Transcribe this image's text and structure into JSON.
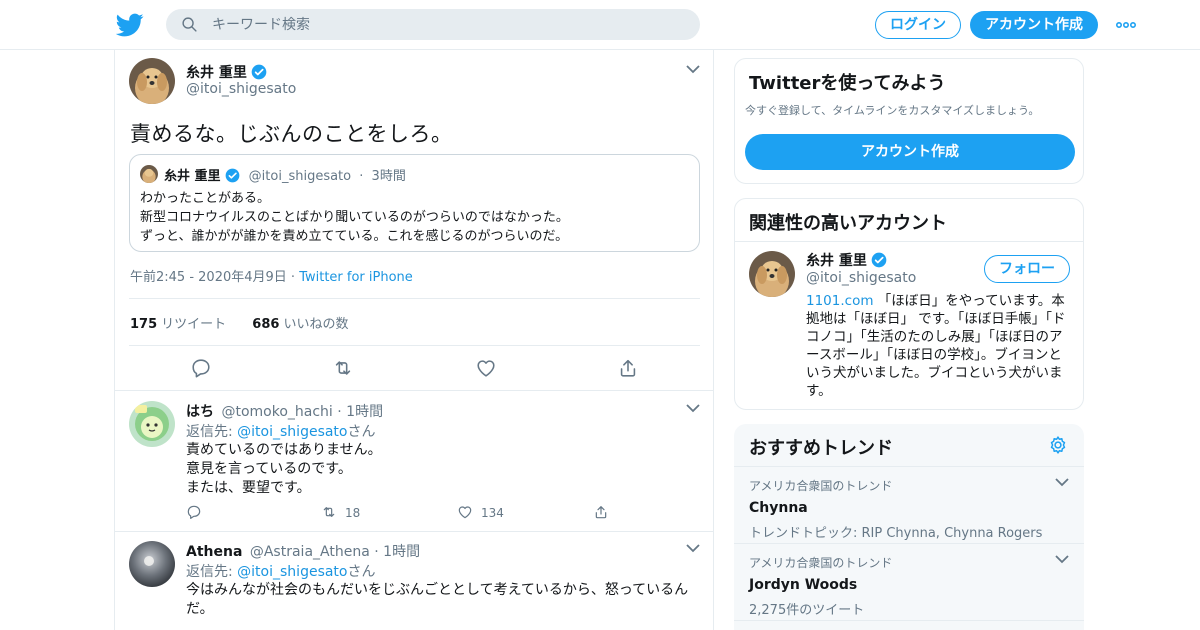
{
  "header": {
    "search_placeholder": "キーワード検索",
    "login_label": "ログイン",
    "signup_label": "アカウント作成"
  },
  "main_tweet": {
    "name": "糸井 重里",
    "handle": "@itoi_shigesato",
    "text": "責めるな。じぶんのことをしろ。",
    "quote": {
      "name": "糸井 重里",
      "handle": "@itoi_shigesato",
      "time": "3時間",
      "lines": [
        "わかったことがある。",
        "新型コロナウイルスのことばかり聞いているのがつらいのではなかった。",
        "ずっと、誰かがが誰かを責め立てている。これを感じるのがつらいのだ。"
      ]
    },
    "timestamp": "午前2:45 - 2020年4月9日",
    "source": "Twitter for iPhone",
    "retweets": "175",
    "retweets_label": "リツイート",
    "likes": "686",
    "likes_label": "いいねの数"
  },
  "replies": [
    {
      "name": "はち",
      "handle": "@tomoko_hachi",
      "time": "1時間",
      "reply_prefix": "返信先: ",
      "reply_to": "@itoi_shigesato",
      "reply_suffix": "さん",
      "lines": [
        "責めているのではありません。",
        "意見を言っているのです。",
        "または、要望です。"
      ],
      "retweets": "18",
      "likes": "134"
    },
    {
      "name": "Athena",
      "handle": "@Astraia_Athena",
      "time": "1時間",
      "reply_prefix": "返信先: ",
      "reply_to": "@itoi_shigesato",
      "reply_suffix": "さん",
      "lines": [
        "今はみんなが社会のもんだいをじぶんごととして考えているから、怒っているんだ。"
      ]
    }
  ],
  "signup_card": {
    "title": "Twitterを使ってみよう",
    "desc": "今すぐ登録して、タイムラインをカスタマイズしましょう。",
    "cta": "アカウント作成"
  },
  "related_card": {
    "title": "関連性の高いアカウント",
    "name": "糸井 重里",
    "handle": "@itoi_shigesato",
    "follow_label": "フォロー",
    "bio_link": "1101.com",
    "bio_text": " 「ほぼ日」をやっています。本拠地は「ほぼ日」 です。「ほぼ日手帳」「ドコノコ」「生活のたのしみ展」「ほぼ日のアースボール」「ほぼ日の学校」。ブイヨンという犬がいました。ブイコという犬がいます。"
  },
  "trends_card": {
    "title": "おすすめトレンド",
    "trends": [
      {
        "context": "アメリカ合衆国のトレンド",
        "name": "Chynna",
        "meta": "トレンドトピック: RIP Chynna, Chynna Rogers"
      },
      {
        "context": "アメリカ合衆国のトレンド",
        "name": "Jordyn Woods",
        "meta": "2,275件のツイート"
      }
    ]
  },
  "colors": {
    "accent": "#1da1f2",
    "link": "#1b95e0",
    "text": "#14171a",
    "muted": "#657786",
    "border": "#e6ecf0"
  }
}
